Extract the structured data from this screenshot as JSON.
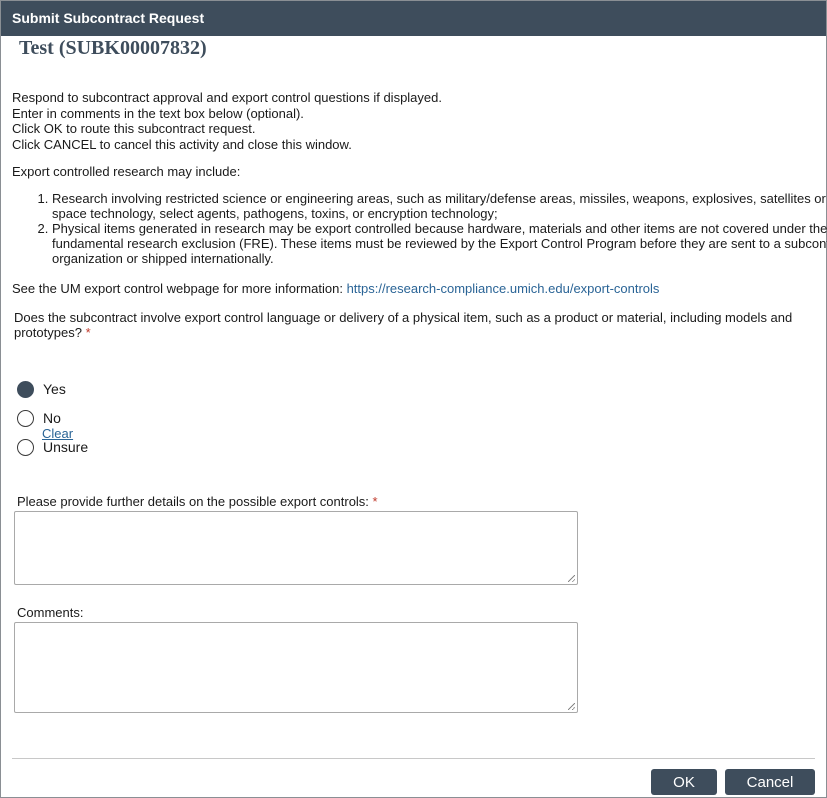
{
  "window": {
    "title": "Submit Subcontract Request"
  },
  "heading": "Test (SUBK00007832)",
  "intro": [
    "Respond to subcontract approval and export control questions if displayed.",
    "Enter in comments in the text box below (optional).",
    "Click OK to route this subcontract request.",
    "Click CANCEL to cancel this activity and close this window."
  ],
  "export": {
    "title": "Export controlled research may include:",
    "items": [
      "Research involving restricted science or engineering areas, such as military/defense areas, missiles, weapons, explosives, satellites or space technology, select agents, pathogens, toxins, or encryption technology;",
      "Physical items generated in research may be export controlled because hardware, materials and other items are not covered under the fundamental research exclusion (FRE). These items must be reviewed by the Export Control Program before they are sent to a subcontract organization or shipped internationally."
    ]
  },
  "more_info": {
    "text": "See the UM export control webpage for more information: ",
    "link": "https://research-compliance.umich.edu/export-controls"
  },
  "question": {
    "text": "Does the subcontract involve export control language or delivery of a physical item, such as a product or material, including models and prototypes?",
    "required_mark": "*",
    "options": [
      {
        "label": "Yes",
        "checked": true
      },
      {
        "label": "No",
        "checked": false
      },
      {
        "label": "Unsure",
        "checked": false
      }
    ],
    "clear_label": "Clear"
  },
  "details_field": {
    "label": "Please provide further details on the possible export controls: ",
    "required_mark": "*",
    "value": ""
  },
  "comments_field": {
    "label": "Comments:",
    "value": ""
  },
  "buttons": {
    "ok": "OK",
    "cancel": "Cancel"
  },
  "colors": {
    "titlebar": "#3e4d5c",
    "link": "#2a6496",
    "required": "#c0392b"
  }
}
